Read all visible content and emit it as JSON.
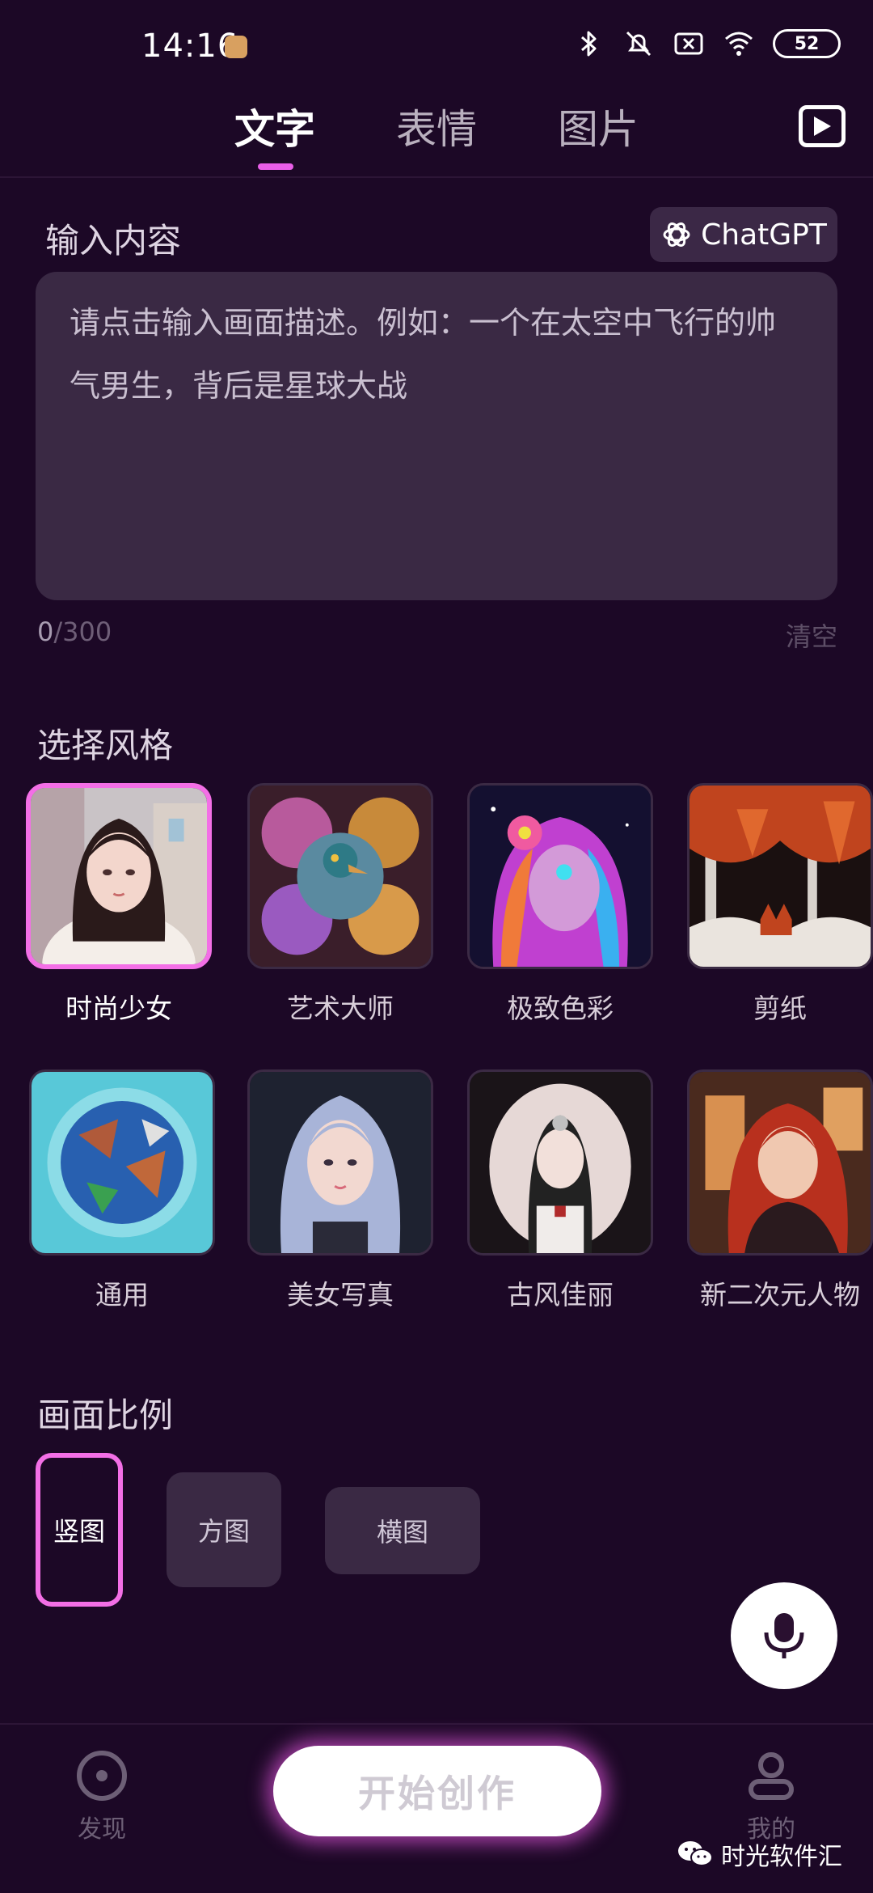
{
  "status_bar": {
    "time": "14:16",
    "battery": "52"
  },
  "tabs": [
    {
      "label": "文字",
      "active": true
    },
    {
      "label": "表情",
      "active": false
    },
    {
      "label": "图片",
      "active": false
    }
  ],
  "input": {
    "label": "输入内容",
    "chatgpt_label": "ChatGPT",
    "placeholder": "请点击输入画面描述。例如：一个在太空中飞行的帅气男生，背后是星球大战",
    "value": "",
    "count": "0",
    "max": "/300",
    "clear_label": "清空"
  },
  "styles": {
    "label": "选择风格",
    "items": [
      {
        "name": "时尚少女",
        "selected": true
      },
      {
        "name": "艺术大师",
        "selected": false
      },
      {
        "name": "极致色彩",
        "selected": false
      },
      {
        "name": "剪纸",
        "selected": false
      },
      {
        "name": "通用",
        "selected": false
      },
      {
        "name": "美女写真",
        "selected": false
      },
      {
        "name": "古风佳丽",
        "selected": false
      },
      {
        "name": "新二次元人物",
        "selected": false
      }
    ]
  },
  "ratio": {
    "label": "画面比例",
    "options": [
      {
        "label": "竖图",
        "selected": true
      },
      {
        "label": "方图",
        "selected": false
      },
      {
        "label": "横图",
        "selected": false
      }
    ]
  },
  "bottom_nav": {
    "discover": "发现",
    "start": "开始创作",
    "mine": "我的"
  },
  "watermark": "时光软件汇",
  "colors": {
    "background": "#1c0826",
    "accent": "#f36fe6",
    "panel": "#3a2944"
  }
}
